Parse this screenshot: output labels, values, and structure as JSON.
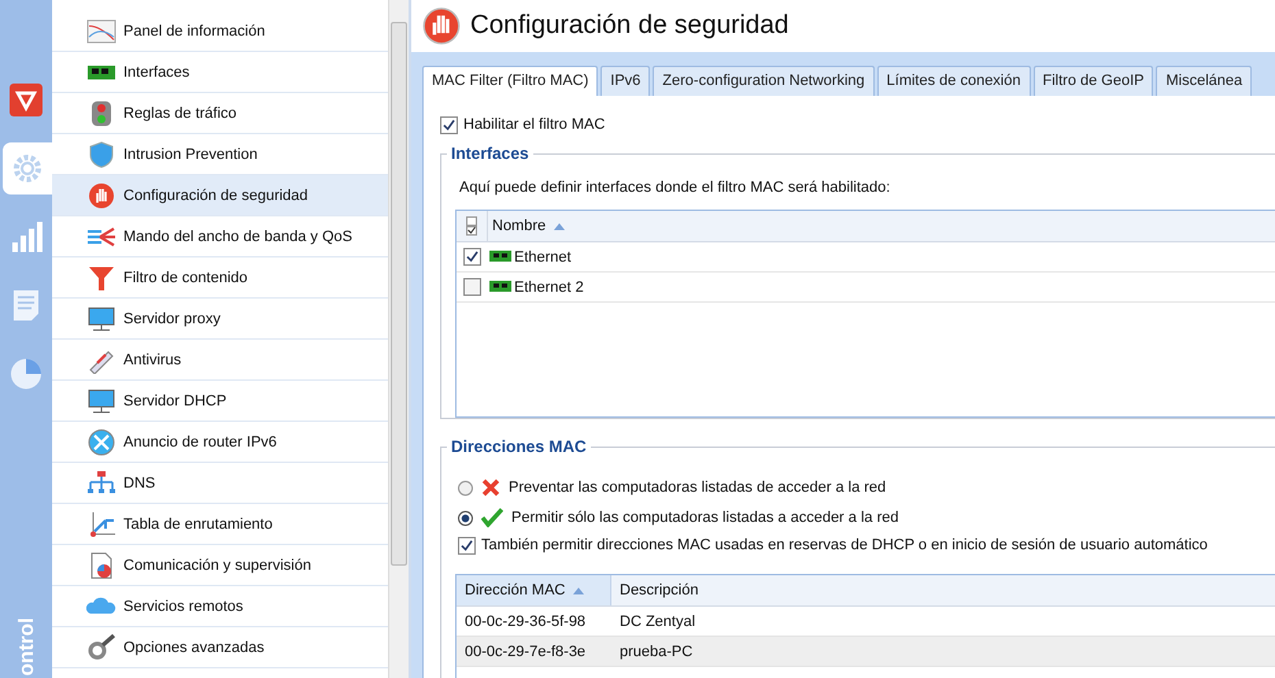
{
  "rail": {
    "items": [
      {
        "selected": false
      },
      {
        "selected": true
      },
      {
        "selected": false
      },
      {
        "selected": false
      },
      {
        "selected": false
      }
    ],
    "label": "ontrol"
  },
  "sidebar": {
    "items": [
      {
        "label": "Panel de información",
        "selected": false
      },
      {
        "label": "Interfaces",
        "selected": false
      },
      {
        "label": "Reglas de tráfico",
        "selected": false
      },
      {
        "label": "Intrusion Prevention",
        "selected": false
      },
      {
        "label": "Configuración de seguridad",
        "selected": true
      },
      {
        "label": "Mando del ancho de banda y QoS",
        "selected": false
      },
      {
        "label": "Filtro de contenido",
        "selected": false
      },
      {
        "label": "Servidor proxy",
        "selected": false
      },
      {
        "label": "Antivirus",
        "selected": false
      },
      {
        "label": "Servidor DHCP",
        "selected": false
      },
      {
        "label": "Anuncio de router IPv6",
        "selected": false
      },
      {
        "label": "DNS",
        "selected": false
      },
      {
        "label": "Tabla de enrutamiento",
        "selected": false
      },
      {
        "label": "Comunicación y supervisión",
        "selected": false
      },
      {
        "label": "Servicios remotos",
        "selected": false
      },
      {
        "label": "Opciones avanzadas",
        "selected": false
      }
    ]
  },
  "page": {
    "title": "Configuración de seguridad"
  },
  "tabs": [
    {
      "label": "MAC Filter (Filtro MAC)",
      "selected": true
    },
    {
      "label": "IPv6",
      "selected": false
    },
    {
      "label": "Zero-configuration Networking",
      "selected": false
    },
    {
      "label": "Límites de conexión",
      "selected": false
    },
    {
      "label": "Filtro de GeoIP",
      "selected": false
    },
    {
      "label": "Miscelánea",
      "selected": false
    }
  ],
  "enable_filter": {
    "label": "Habilitar el filtro MAC",
    "checked": true
  },
  "interfaces": {
    "title": "Interfaces",
    "description": "Aquí puede definir interfaces donde el filtro MAC será habilitado:",
    "column": "Nombre",
    "rows": [
      {
        "name": "Ethernet",
        "checked": true
      },
      {
        "name": "Ethernet 2",
        "checked": false
      }
    ]
  },
  "mac_addresses": {
    "title": "Direcciones MAC",
    "options": [
      {
        "kind": "deny",
        "label": "Preventar las computadoras listadas de acceder a la red",
        "selected": false
      },
      {
        "kind": "allow",
        "label": "Permitir sólo las computadoras listadas a acceder a la red",
        "selected": true
      }
    ],
    "also_allow": {
      "label": "También permitir direcciones MAC usadas en reservas de DHCP o en inicio de sesión de usuario automático",
      "checked": true
    },
    "columns": [
      "Dirección MAC",
      "Descripción"
    ],
    "rows": [
      {
        "mac": "00-0c-29-36-5f-98",
        "description": "DC Zentyal",
        "selected": false
      },
      {
        "mac": "00-0c-29-7e-f8-3e",
        "description": "prueba-PC",
        "selected": true
      }
    ]
  }
}
